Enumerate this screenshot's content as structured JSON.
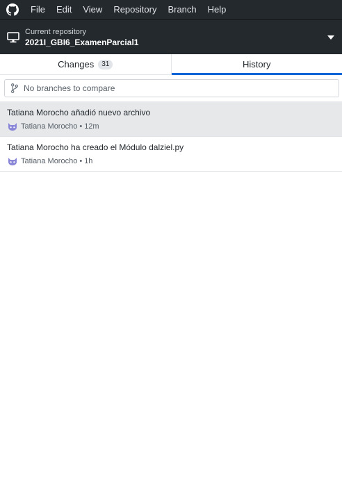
{
  "menubar": {
    "items": [
      "File",
      "Edit",
      "View",
      "Repository",
      "Branch",
      "Help"
    ]
  },
  "repository": {
    "caption": "Current repository",
    "name": "2021I_GBI6_ExamenParcial1"
  },
  "tabs": {
    "changes": {
      "label": "Changes",
      "count": "31"
    },
    "history": {
      "label": "History"
    }
  },
  "compare": {
    "placeholder": "No branches to compare"
  },
  "commits": [
    {
      "title": "Tatiana Morocho añadió nuevo archivo",
      "author": "Tatiana Morocho",
      "separator": "•",
      "time": "12m"
    },
    {
      "title": "Tatiana Morocho ha creado el Módulo dalziel.py",
      "author": "Tatiana Morocho",
      "separator": "•",
      "time": "1h"
    }
  ],
  "colors": {
    "chrome": "#24292e",
    "accent": "#0366d6",
    "selected_row": "#e6e8ea",
    "avatar": "#8a86d8"
  },
  "icons": {
    "app": "github-icon",
    "repo": "desktop-computer-icon",
    "caret": "caret-down-icon",
    "branch": "git-branch-icon",
    "avatar": "octocat-avatar-icon"
  }
}
